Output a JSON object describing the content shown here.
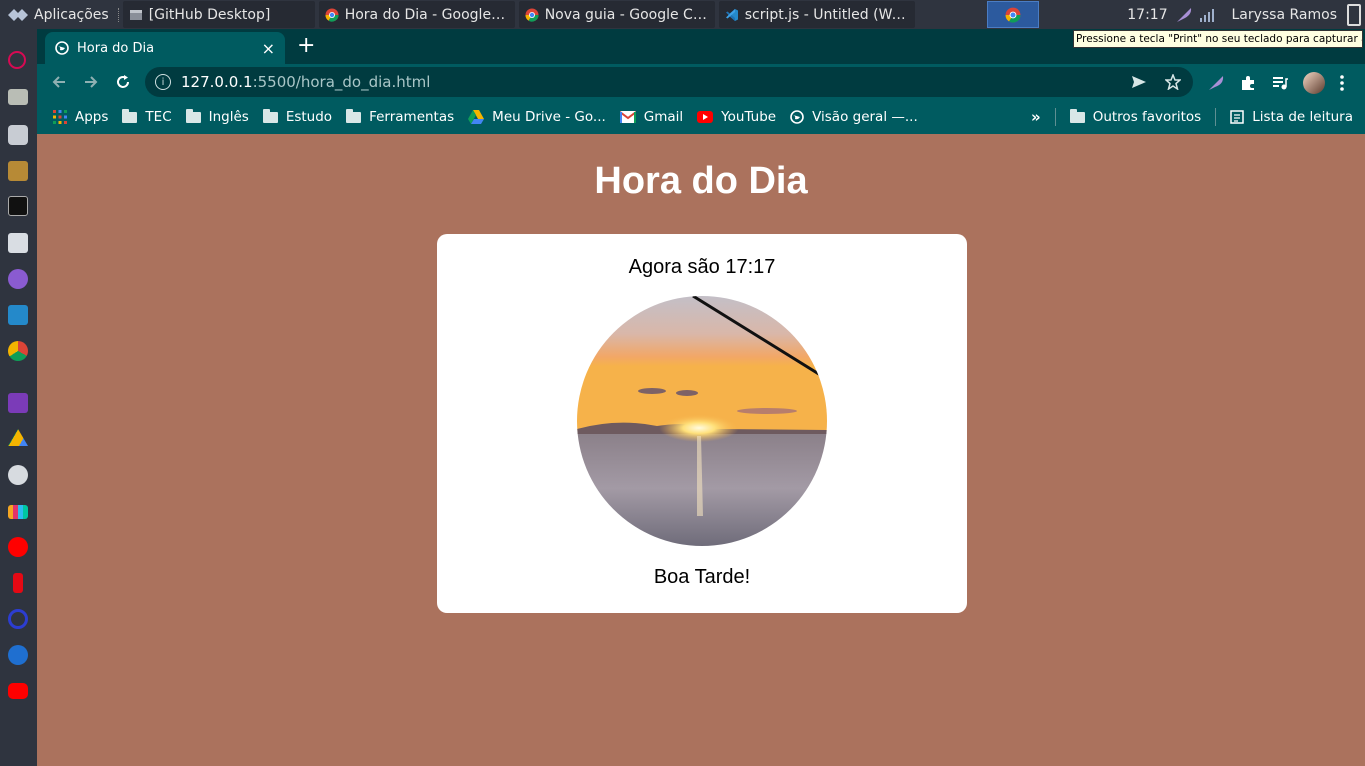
{
  "panel": {
    "apps_label": "Aplicações",
    "tasks": [
      {
        "label": "[GitHub Desktop]"
      },
      {
        "label": "Hora do Dia - Google C..."
      },
      {
        "label": "Nova guia - Google Chr..."
      },
      {
        "label": "script.js - Untitled (Wor..."
      }
    ],
    "clock": "17:17",
    "user": "Laryssa Ramos",
    "tooltip": "Pressione a tecla \"Print\" no seu teclado para capturar a tela"
  },
  "browser": {
    "tab_title": "Hora do Dia",
    "url_host": "127.0.0.1",
    "url_path": ":5500/hora_do_dia.html",
    "bookmarks": [
      {
        "label": "Apps",
        "icon": "apps-grid-icon"
      },
      {
        "label": "TEC",
        "icon": "folder-icon"
      },
      {
        "label": "Inglês",
        "icon": "folder-icon"
      },
      {
        "label": "Estudo",
        "icon": "folder-icon"
      },
      {
        "label": "Ferramentas",
        "icon": "folder-icon"
      },
      {
        "label": "Meu Drive - Go...",
        "icon": "google-drive-icon"
      },
      {
        "label": "Gmail",
        "icon": "gmail-icon"
      },
      {
        "label": "YouTube",
        "icon": "youtube-icon"
      },
      {
        "label": "Visão geral —...",
        "icon": "globe-icon"
      }
    ],
    "other_bookmarks": "Outros favoritos",
    "reading_list": "Lista de leitura"
  },
  "page": {
    "title": "Hora do Dia",
    "time_message": "Agora são 17:17",
    "greeting": "Boa Tarde!",
    "image_description_icon": "sunset-photo"
  },
  "colors": {
    "page_background": "#ab725d",
    "chrome_frame": "#005b60",
    "chrome_tabbar": "#003b40",
    "card": "#ffffff"
  }
}
